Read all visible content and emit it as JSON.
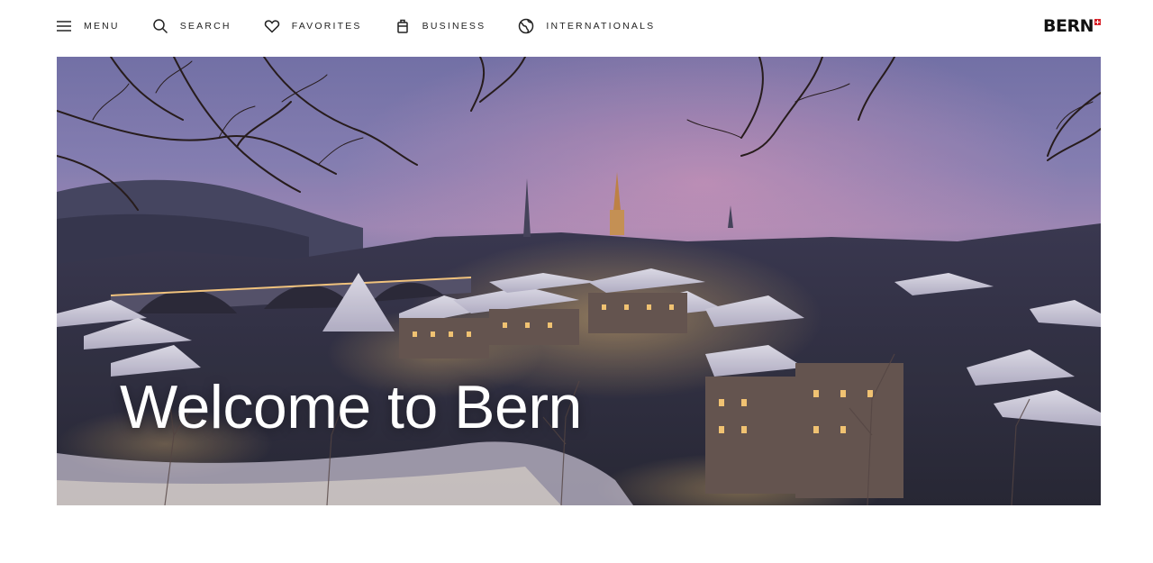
{
  "nav": {
    "items": [
      {
        "label": "MENU",
        "icon": "hamburger-icon"
      },
      {
        "label": "SEARCH",
        "icon": "search-icon"
      },
      {
        "label": "FAVORITES",
        "icon": "heart-icon"
      },
      {
        "label": "BUSINESS",
        "icon": "briefcase-icon"
      },
      {
        "label": "INTERNATIONALS",
        "icon": "globe-icon"
      }
    ]
  },
  "logo": {
    "text": "BERN",
    "flag_color": "#d8232a"
  },
  "hero": {
    "title": "Welcome to Bern",
    "image": "winter-bern-cityscape"
  }
}
